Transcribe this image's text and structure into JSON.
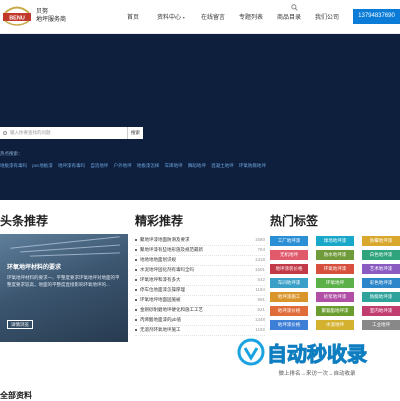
{
  "brand": {
    "logo_text": "BENU",
    "name_line1": "贝努",
    "name_line2": "地坪服务商"
  },
  "nav": {
    "items": [
      "首页",
      "资料中心",
      "在线留言",
      "专题列表",
      "商品目录",
      "我们公司"
    ],
    "caret": "▾"
  },
  "phone": "13794837690",
  "hero": {
    "search_placeholder": "输入你要查找的问题",
    "search_button": "搜索",
    "hot_label": "热点搜索：",
    "hot_links": [
      "地板漆有毒吗",
      "pvc地板漆",
      "地坪漆有毒吗",
      "自流地坪",
      "户外地坪",
      "地板漆怎样",
      "车库地坪",
      "舞蹈地坪",
      "混凝土地坪",
      "环氧防腐地坪"
    ]
  },
  "sections": {
    "headline": "头条推荐",
    "featured": "精彩推荐",
    "tags": "热门标签",
    "all": "全部资料"
  },
  "feature": {
    "title": "环氧地坪材料的要求",
    "desc": "环氧地坪材料的要求一、平整度要求环氧地坪对地面的平整度要求较高，地面的平整度直接影响环氧地坪的...",
    "button": "详情浏览"
  },
  "list": [
    {
      "title": "聚地坪漆地面防滑及要求",
      "num": "1580"
    },
    {
      "title": "聚地坪漆有些地形施及规范最新",
      "num": "784"
    },
    {
      "title": "地地地地面划识规",
      "num": "1318"
    },
    {
      "title": "水泥地坪固化剂有毒吗全吗",
      "num": "1501"
    },
    {
      "title": "环氧地坪和漆有多大",
      "num": "542"
    },
    {
      "title": "停车位地面漆怎操厚理",
      "num": "1184"
    },
    {
      "title": "环氧地坪地面固施被",
      "num": "891"
    },
    {
      "title": "金刚砂耐磨地坪硬化和施工工艺",
      "num": "521"
    },
    {
      "title": "丙烯酸地面漆的pb值",
      "num": "1348"
    },
    {
      "title": "无溶剂环氧地坪施工",
      "num": "1192"
    }
  ],
  "tags": [
    {
      "label": "工厂地坪漆",
      "color": "#2b8fd6"
    },
    {
      "label": "球场地坪漆",
      "color": "#1aa8c8"
    },
    {
      "label": "防霉地坪漆",
      "color": "#d8a72c"
    },
    {
      "label": "无机地坪",
      "color": "#e05a6b"
    },
    {
      "label": "防水地坪漆",
      "color": "#6f9b3a"
    },
    {
      "label": "白色地坪漆",
      "color": "#2fa37b"
    },
    {
      "label": "地坪涂装价格",
      "color": "#c23a47"
    },
    {
      "label": "环氧地坪漆",
      "color": "#d7503e"
    },
    {
      "label": "艺术地坪漆",
      "color": "#8a5cc2"
    },
    {
      "label": "车间地坪漆",
      "color": "#3aa0c8"
    },
    {
      "label": "环氧地坪",
      "color": "#5bb04a"
    },
    {
      "label": "彩色地坪漆",
      "color": "#2c86c9"
    },
    {
      "label": "地坪漆施工",
      "color": "#d9942a"
    },
    {
      "label": "砂浆地坪漆",
      "color": "#b04fa5"
    },
    {
      "label": "防腐地坪漆",
      "color": "#2fa39b"
    },
    {
      "label": "地坪漆价格",
      "color": "#e06c3a"
    },
    {
      "label": "聚氨酯地坪漆",
      "color": "#6a9d2f"
    },
    {
      "label": "室内地坪漆",
      "color": "#c13d70"
    },
    {
      "label": "地坪漆价格",
      "color": "#3d7fd6"
    },
    {
      "label": "水泥地坪",
      "color": "#d4b22f"
    },
    {
      "label": "工业地坪",
      "color": "#888888"
    }
  ],
  "watermark": {
    "text": "自动秒收录",
    "sub": "做上排名→来访一次→自动收录"
  }
}
